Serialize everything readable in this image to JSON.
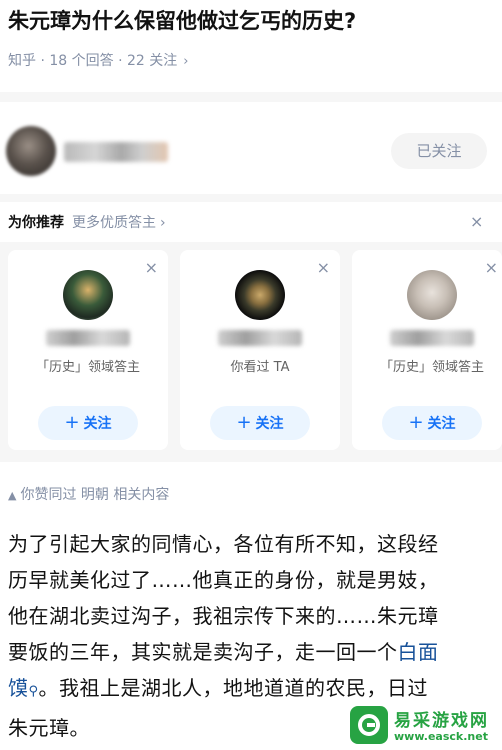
{
  "question": {
    "title": "朱元璋为什么保留他做过乞丐的历史?",
    "meta": "知乎 · 18 个回答 · 22 关注",
    "meta_chevron": "›"
  },
  "author": {
    "followed_label": "已关注"
  },
  "recommend": {
    "title": "为你推荐",
    "more": "更多优质答主",
    "chevron": "›",
    "close_glyph": "×",
    "cards": [
      {
        "desc": "「历史」领域答主",
        "follow_label": "关注",
        "plus": "+",
        "close": "×"
      },
      {
        "desc": "你看过 TA",
        "follow_label": "关注",
        "plus": "+",
        "close": "×"
      },
      {
        "desc": "「历史」领域答主",
        "follow_label": "关注",
        "plus": "+",
        "close": "×"
      }
    ]
  },
  "answer": {
    "hint_icon": "▲",
    "hint": "你赞同过 明朝 相关内容",
    "lines": [
      "为了引起大家的同情心，各位有所不知，这段经",
      "历早就美化过了……他真正的身份，就是男妓，",
      "他在湖北卖过沟子，我祖宗传下来的……朱元璋",
      "要饭的三年，其实就是卖沟子，走一回一个"
    ],
    "link_part1": "白面",
    "link_part2": "馍",
    "search_glyph": "⚲",
    "line5_rest": "。我祖上是湖北人，地地道道的农民，日过",
    "line6": "朱元璋。"
  },
  "watermark": {
    "name": "易采游戏网",
    "url": "www.easck.net",
    "logo_color": "#27a343"
  }
}
